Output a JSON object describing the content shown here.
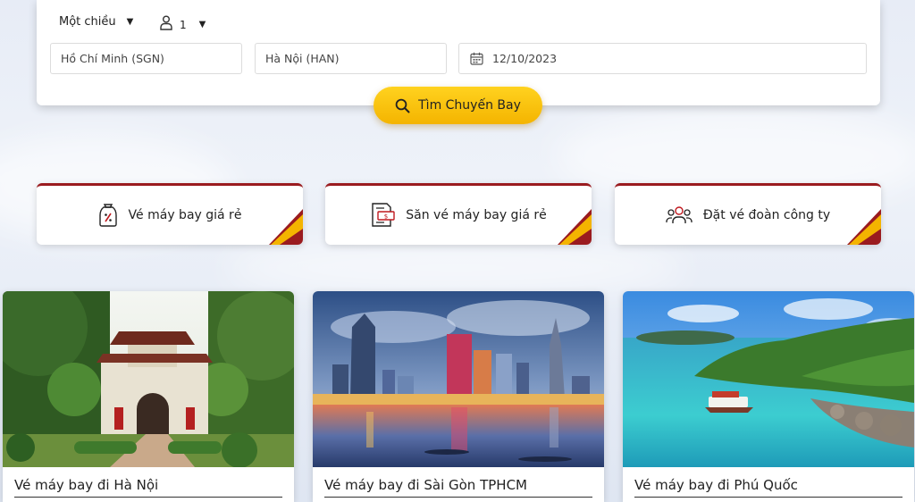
{
  "search": {
    "trip_type": "Một chiều",
    "passenger_count": "1",
    "from": "Hồ Chí Minh (SGN)",
    "to": "Hà Nội (HAN)",
    "date": "12/10/2023",
    "search_button": "Tìm Chuyến Bay"
  },
  "services": [
    {
      "label": "Vé máy bay giá rẻ",
      "icon": "discount-tag-icon"
    },
    {
      "label": "Săn vé máy bay giá rẻ",
      "icon": "ticket-hunt-icon"
    },
    {
      "label": "Đặt vé đoàn công ty",
      "icon": "group-icon"
    }
  ],
  "destinations": [
    {
      "title": "Vé máy bay đi Hà Nội",
      "image": "temple-of-literature-photo"
    },
    {
      "title": "Vé máy bay đi Sài Gòn TPHCM",
      "image": "saigon-skyline-photo"
    },
    {
      "title": "Vé máy bay đi Phú Quốc",
      "image": "phu-quoc-island-photo"
    }
  ],
  "colors": {
    "accent_yellow": "#f4b400",
    "accent_red": "#9a1b1f"
  }
}
